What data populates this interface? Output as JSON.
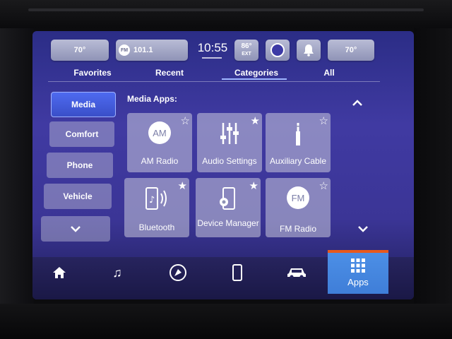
{
  "status": {
    "temp_left": "70°",
    "radio_band": "FM",
    "radio_station": "101.1",
    "clock": "10:55",
    "exterior_temp": "86°",
    "exterior_label": "EXT",
    "temp_right": "70°"
  },
  "tabs": {
    "favorites": "Favorites",
    "recent": "Recent",
    "categories": "Categories",
    "all": "All",
    "active": "Categories"
  },
  "sidebar": {
    "items": [
      "Media",
      "Comfort",
      "Phone",
      "Vehicle"
    ],
    "active": "Media"
  },
  "main": {
    "section_label": "Media Apps:",
    "tiles": [
      {
        "label": "AM Radio",
        "icon": "AM"
      },
      {
        "label": "Audio Settings",
        "icon": "sliders-icon"
      },
      {
        "label": "Auxiliary Cable",
        "icon": "aux-plug-icon"
      },
      {
        "label": "Bluetooth",
        "icon": "phone-sound-icon"
      },
      {
        "label": "Device Manager",
        "icon": "phone-gear-icon"
      },
      {
        "label": "FM Radio",
        "icon": "FM"
      }
    ]
  },
  "bottom_nav": {
    "apps_label": "Apps",
    "active": "Apps"
  },
  "colors": {
    "accent": "#4c8fe6",
    "active_bar": "#e8591c",
    "screen_bg": "#3b3596"
  }
}
